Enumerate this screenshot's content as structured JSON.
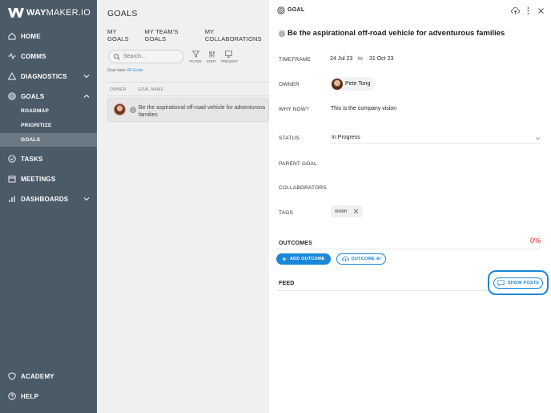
{
  "brand": {
    "bold": "WAY",
    "rest": "MAKER.IO"
  },
  "sidebar": {
    "items": [
      {
        "label": "HOME",
        "icon": "home-icon"
      },
      {
        "label": "COMMS",
        "icon": "pulse-icon"
      },
      {
        "label": "DIAGNOSTICS",
        "icon": "warning-icon"
      },
      {
        "label": "GOALS",
        "icon": "target-icon"
      },
      {
        "label": "TASKS",
        "icon": "check-circle-icon"
      },
      {
        "label": "MEETINGS",
        "icon": "calendar-icon"
      },
      {
        "label": "DASHBOARDS",
        "icon": "bar-chart-icon"
      },
      {
        "label": "ACADEMY",
        "icon": "shield-icon"
      },
      {
        "label": "HELP",
        "icon": "help-icon"
      }
    ],
    "goals_sub": [
      "ROADMAP",
      "PRIORITIZE",
      "GOALS"
    ],
    "active_sub": "GOALS"
  },
  "goals_panel": {
    "title": "GOALS",
    "tabs": [
      "MY GOALS",
      "MY TEAM'S GOALS",
      "MY COLLABORATIONS"
    ],
    "search_placeholder": "Search...",
    "tools": [
      "FILTER",
      "SORT",
      "PRESENT"
    ],
    "goal_view_label": "Goal view:",
    "goal_view_value": "All Goals",
    "columns": [
      "OWNER",
      "GOAL NAME"
    ],
    "rows": [
      {
        "name": "Be the aspirational off-road vehicle for adventurous families"
      }
    ]
  },
  "goal_detail": {
    "header": "GOAL",
    "title": "Be the aspirational off-road vehicle for adventurous families",
    "timeframe_label": "TIMEFRAME",
    "timeframe_start": "24 Jul 23",
    "timeframe_to": "to",
    "timeframe_end": "31 Oct 23",
    "owner_label": "OWNER",
    "owner_name": "Pete Tong",
    "why_label": "WHY NOW?",
    "why_value": "This is the company vision",
    "status_label": "STATUS",
    "status_value": "In Progress",
    "parent_label": "PARENT GOAL",
    "collaborators_label": "COLLABORATORS",
    "tags_label": "TAGS",
    "tags": [
      "vision"
    ],
    "outcomes_label": "OUTCOMES",
    "outcomes_progress": "0%",
    "add_outcome_label": "ADD OUTCOME",
    "outcome_ai_label": "OUTCOME AI",
    "feed_label": "FEED",
    "show_posts_label": "SHOW POSTS"
  },
  "colors": {
    "sidebar": "#4b5a67",
    "accent": "#1a87d9",
    "progress": "#e02424"
  }
}
